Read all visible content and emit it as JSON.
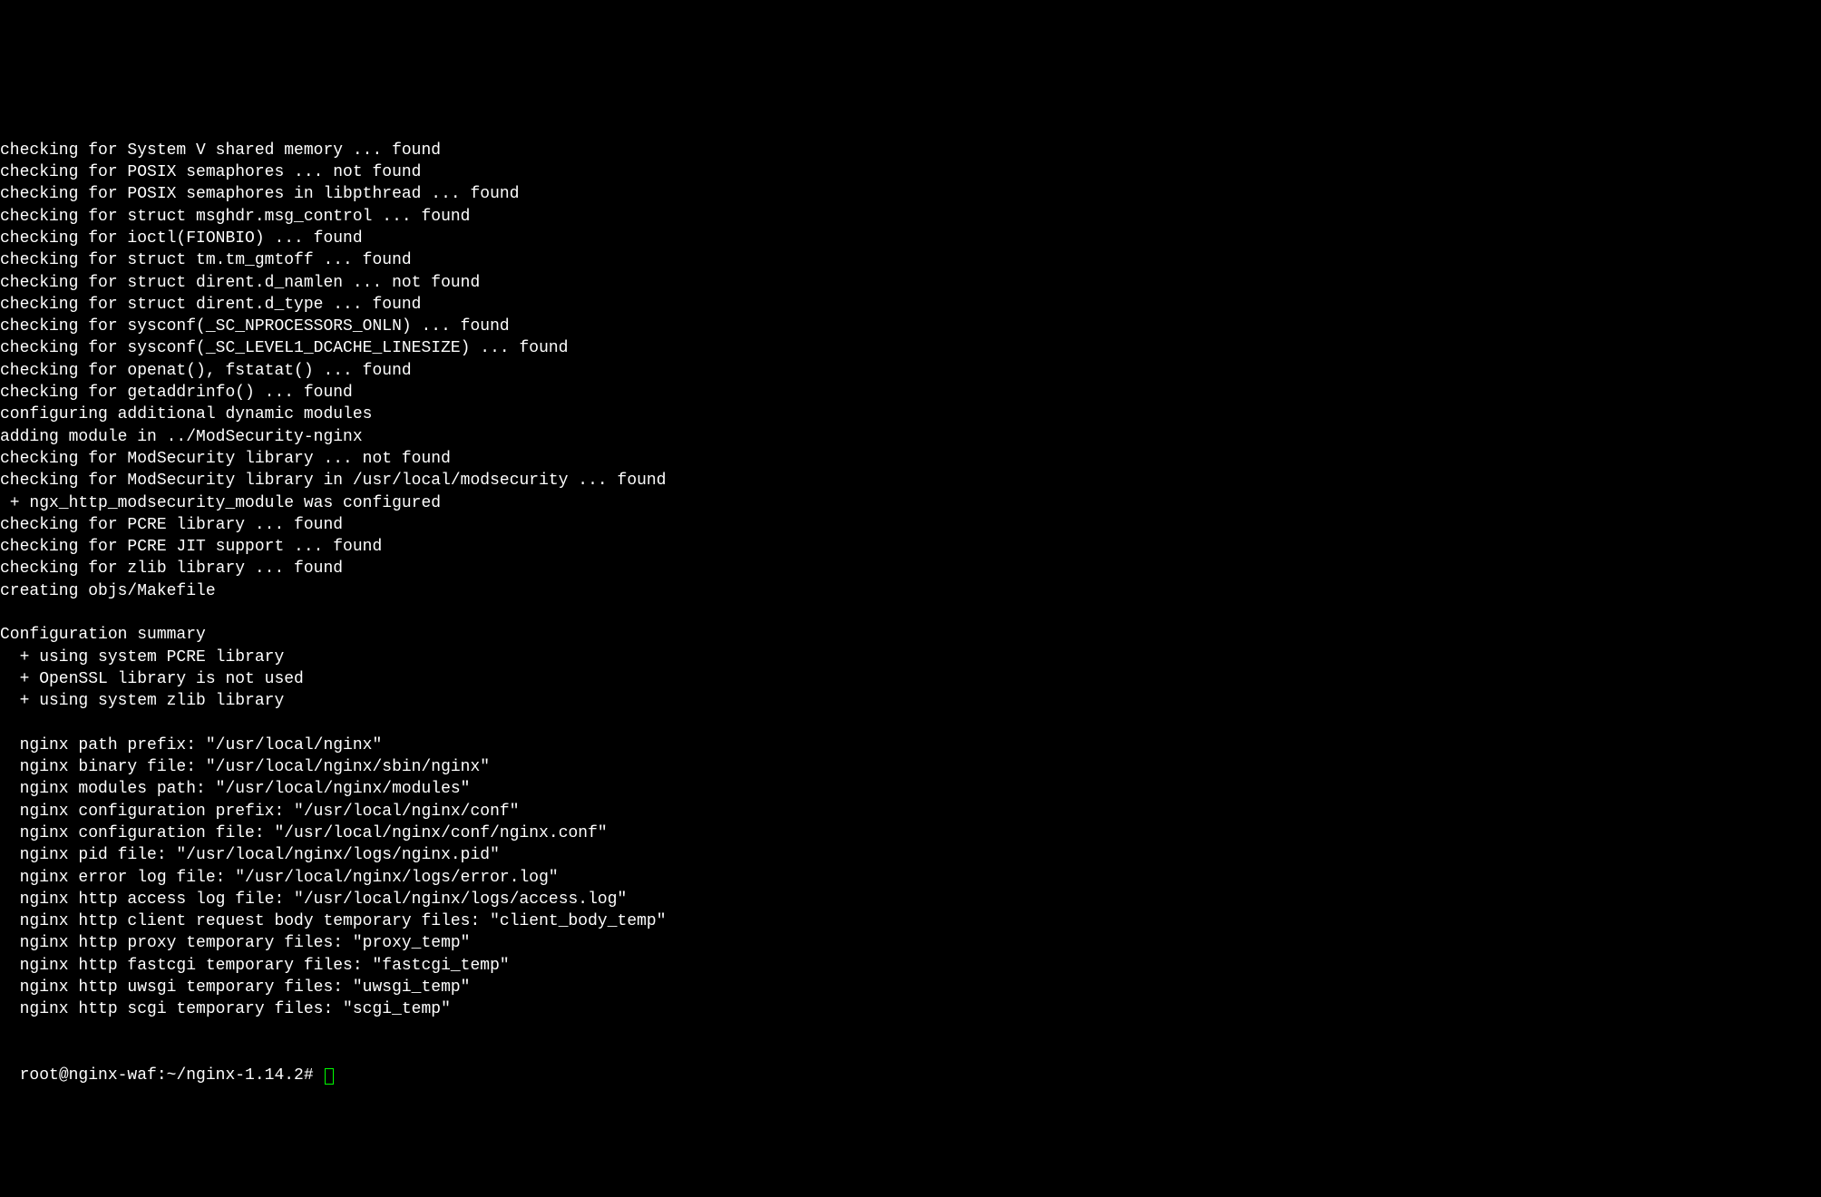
{
  "terminal": {
    "lines": [
      "checking for System V shared memory ... found",
      "checking for POSIX semaphores ... not found",
      "checking for POSIX semaphores in libpthread ... found",
      "checking for struct msghdr.msg_control ... found",
      "checking for ioctl(FIONBIO) ... found",
      "checking for struct tm.tm_gmtoff ... found",
      "checking for struct dirent.d_namlen ... not found",
      "checking for struct dirent.d_type ... found",
      "checking for sysconf(_SC_NPROCESSORS_ONLN) ... found",
      "checking for sysconf(_SC_LEVEL1_DCACHE_LINESIZE) ... found",
      "checking for openat(), fstatat() ... found",
      "checking for getaddrinfo() ... found",
      "configuring additional dynamic modules",
      "adding module in ../ModSecurity-nginx",
      "checking for ModSecurity library ... not found",
      "checking for ModSecurity library in /usr/local/modsecurity ... found",
      " + ngx_http_modsecurity_module was configured",
      "checking for PCRE library ... found",
      "checking for PCRE JIT support ... found",
      "checking for zlib library ... found",
      "creating objs/Makefile",
      "",
      "Configuration summary",
      "  + using system PCRE library",
      "  + OpenSSL library is not used",
      "  + using system zlib library",
      "",
      "  nginx path prefix: \"/usr/local/nginx\"",
      "  nginx binary file: \"/usr/local/nginx/sbin/nginx\"",
      "  nginx modules path: \"/usr/local/nginx/modules\"",
      "  nginx configuration prefix: \"/usr/local/nginx/conf\"",
      "  nginx configuration file: \"/usr/local/nginx/conf/nginx.conf\"",
      "  nginx pid file: \"/usr/local/nginx/logs/nginx.pid\"",
      "  nginx error log file: \"/usr/local/nginx/logs/error.log\"",
      "  nginx http access log file: \"/usr/local/nginx/logs/access.log\"",
      "  nginx http client request body temporary files: \"client_body_temp\"",
      "  nginx http proxy temporary files: \"proxy_temp\"",
      "  nginx http fastcgi temporary files: \"fastcgi_temp\"",
      "  nginx http uwsgi temporary files: \"uwsgi_temp\"",
      "  nginx http scgi temporary files: \"scgi_temp\"",
      ""
    ],
    "prompt": "root@nginx-waf:~/nginx-1.14.2# "
  }
}
